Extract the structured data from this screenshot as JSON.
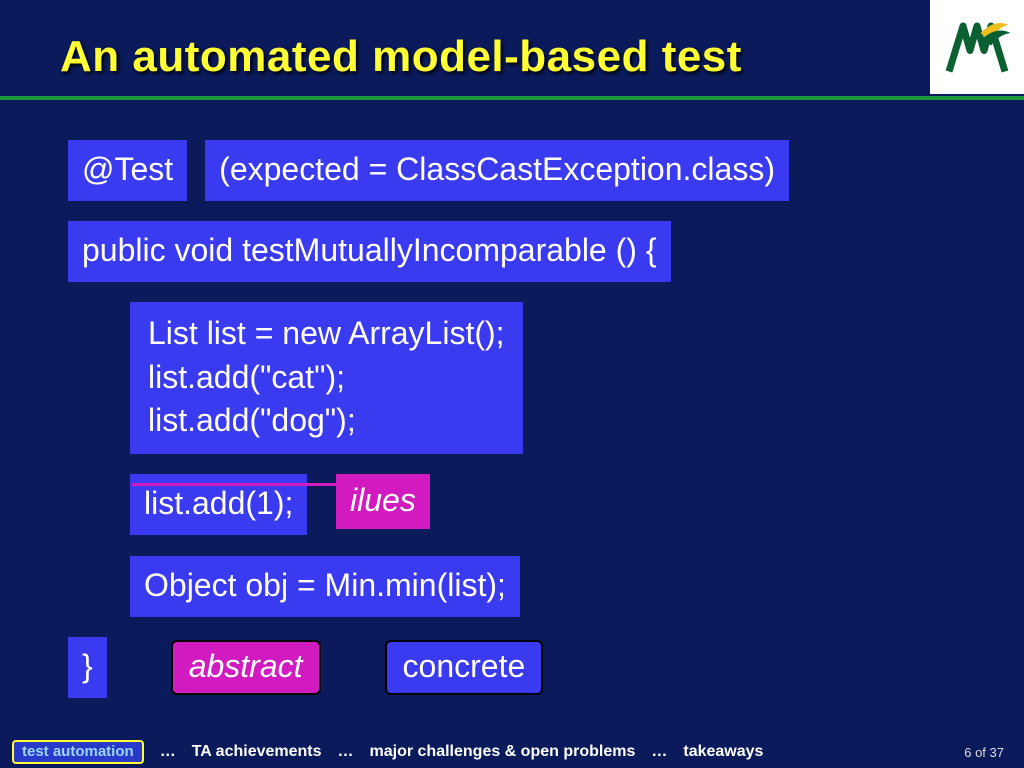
{
  "header": {
    "title": "An automated model-based test"
  },
  "code": {
    "annotation": "@Test",
    "expected": "(expected = ClassCastException.class)",
    "signature": "public void testMutuallyIncomparable () {",
    "block1_l1": "List list = new ArrayList();",
    "block1_l2": "list.add(\"cat\");",
    "block1_l3": "list.add(\"dog\");",
    "block2_peek": "ilues",
    "block2": "list.add(1);",
    "block3": "Object obj = Min.min(list);",
    "close": "}"
  },
  "legend": {
    "abstract": "abstract",
    "concrete": "concrete"
  },
  "footer": {
    "current": "test automation",
    "sep": "…",
    "items": [
      "TA achievements",
      "major challenges & open problems",
      "takeaways"
    ],
    "page": "6 of 37"
  }
}
